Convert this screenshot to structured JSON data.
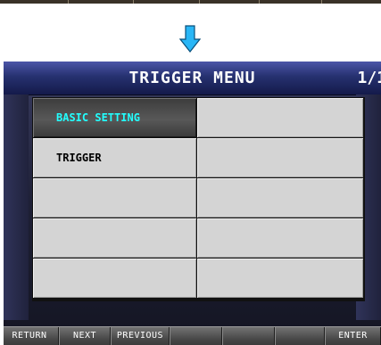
{
  "title": "TRIGGER MENU",
  "page_indicator": "1/1",
  "menu": {
    "items": [
      {
        "label": "BASIC SETTING",
        "selected": true
      },
      {
        "label": ""
      },
      {
        "label": "TRIGGER"
      },
      {
        "label": ""
      },
      {
        "label": ""
      },
      {
        "label": ""
      },
      {
        "label": ""
      },
      {
        "label": ""
      },
      {
        "label": ""
      },
      {
        "label": ""
      }
    ]
  },
  "footer": {
    "return_label": "RETURN",
    "next_label": "NEXT",
    "previous_label": "PREVIOUS",
    "blank1_label": "",
    "blank2_label": "",
    "blank3_label": "",
    "enter_label": "ENTER"
  },
  "icons": {
    "arrow": "arrow-down-icon"
  },
  "colors": {
    "arrow_fill": "#29b6f6",
    "selected_text": "#22ffff",
    "title_bar": "#263170"
  }
}
